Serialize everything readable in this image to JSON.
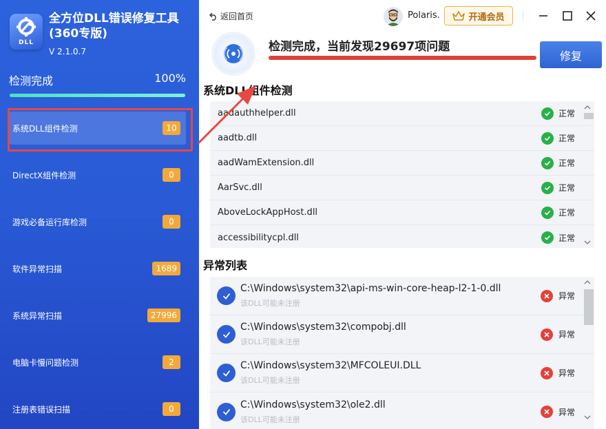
{
  "app": {
    "title": "全方位DLL错误修复工具(360专版)",
    "logo_text": "DLL",
    "version": "V 2.1.0.7"
  },
  "progress": {
    "label": "检测完成",
    "value_text": "100%",
    "fraction": 1.0
  },
  "nav": [
    {
      "label": "系统DLL组件检测",
      "count": "10",
      "active": true
    },
    {
      "label": "DirectX组件检测",
      "count": "0"
    },
    {
      "label": "游戏必备运行库检测",
      "count": "0"
    },
    {
      "label": "软件异常扫描",
      "count": "1689"
    },
    {
      "label": "系统异常扫描",
      "count": "27996"
    },
    {
      "label": "电脑卡慢问题检测",
      "count": "2"
    },
    {
      "label": "注册表错误扫描",
      "count": "0"
    }
  ],
  "topbar": {
    "back_label": "返回首页",
    "username": "Polaris.",
    "vip_label": "开通会员"
  },
  "status": {
    "title": "检测完成，当前发现29697项问题",
    "repair_label": "修复"
  },
  "dll_section": {
    "title": "系统DLL组件检测",
    "items": [
      {
        "name": "aadauthhelper.dll",
        "status": "正常"
      },
      {
        "name": "aadtb.dll",
        "status": "正常"
      },
      {
        "name": "aadWamExtension.dll",
        "status": "正常"
      },
      {
        "name": "AarSvc.dll",
        "status": "正常"
      },
      {
        "name": "AboveLockAppHost.dll",
        "status": "正常"
      },
      {
        "name": "accessibilitycpl.dll",
        "status": "正常"
      }
    ]
  },
  "error_section": {
    "title": "异常列表",
    "items": [
      {
        "path": "C:\\Windows\\system32\\api-ms-win-core-heap-l2-1-0.dll",
        "note": "该DLL可能未注册",
        "status": "异常"
      },
      {
        "path": "C:\\Windows\\system32\\compobj.dll",
        "note": "该DLL可能未注册",
        "status": "异常"
      },
      {
        "path": "C:\\Windows\\system32\\MFCOLEUI.DLL",
        "note": "该DLL可能未注册",
        "status": "异常"
      },
      {
        "path": "C:\\Windows\\system32\\ole2.dll",
        "note": "该DLL可能未注册",
        "status": "异常"
      }
    ]
  },
  "colors": {
    "sidebar": "#2a5bd6",
    "badge": "#f2a93b",
    "ok": "#2ab04a",
    "error": "#e5413b",
    "accent": "#2f63d3",
    "annotation": "#e8483f"
  }
}
